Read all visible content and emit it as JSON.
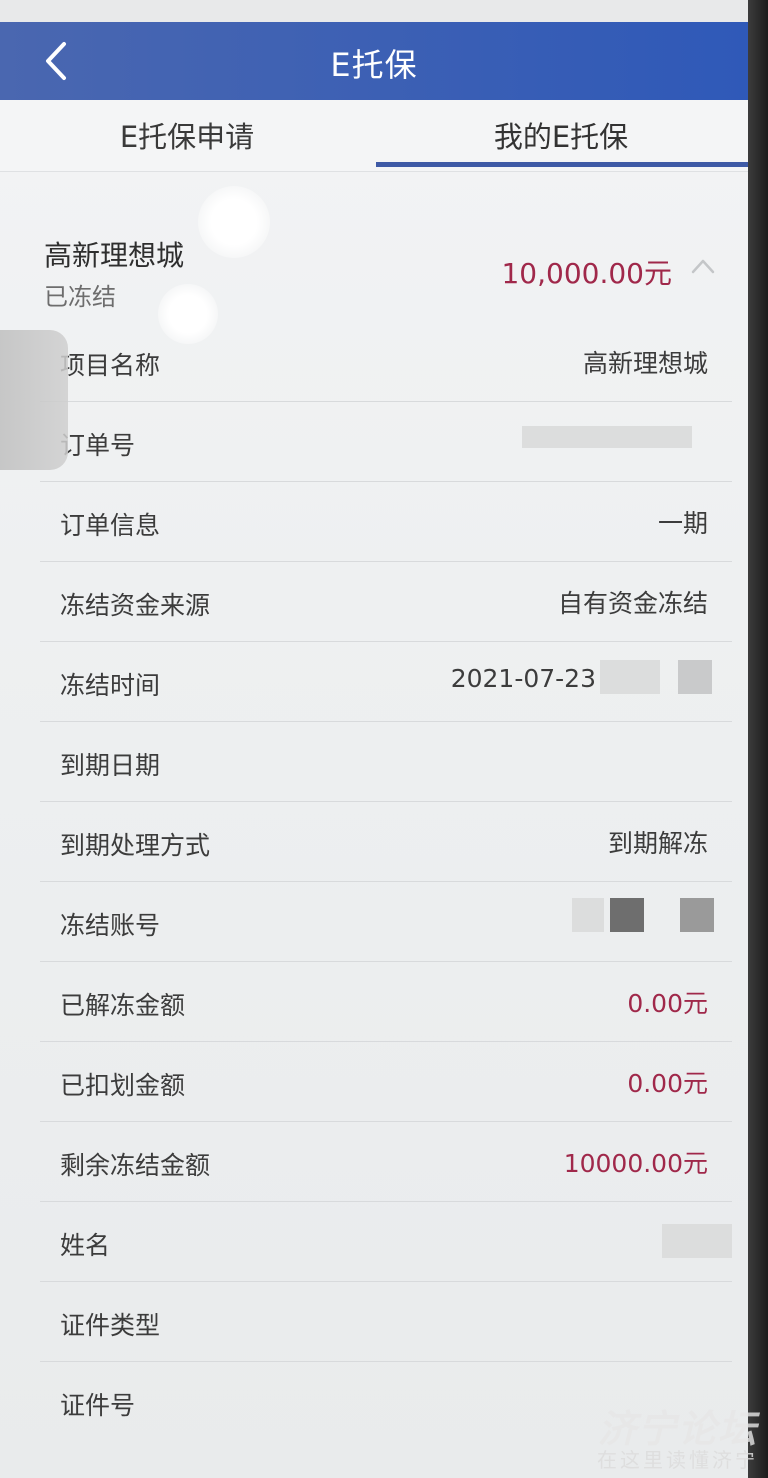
{
  "header": {
    "title": "E托保"
  },
  "tabs": [
    {
      "label": "E托保申请",
      "active": false
    },
    {
      "label": "我的E托保",
      "active": true
    }
  ],
  "summary": {
    "project_name": "高新理想城",
    "status": "已冻结",
    "amount": "10,000.00元"
  },
  "details": [
    {
      "label": "项目名称",
      "value": "高新理想城"
    },
    {
      "label": "订单号",
      "value": ""
    },
    {
      "label": "订单信息",
      "value": "一期"
    },
    {
      "label": "冻结资金来源",
      "value": "自有资金冻结"
    },
    {
      "label": "冻结时间",
      "value": "2021-07-23"
    },
    {
      "label": "到期日期",
      "value": ""
    },
    {
      "label": "到期处理方式",
      "value": "到期解冻"
    },
    {
      "label": "冻结账号",
      "value": ""
    },
    {
      "label": "已解冻金额",
      "value": "0.00元"
    },
    {
      "label": "已扣划金额",
      "value": "0.00元"
    },
    {
      "label": "剩余冻结金额",
      "value": "10000.00元"
    },
    {
      "label": "姓名",
      "value": ""
    },
    {
      "label": "证件类型",
      "value": ""
    },
    {
      "label": "证件号",
      "value": ""
    }
  ],
  "watermark": {
    "main": "济宁论坛",
    "sub": "在这里读懂济宁"
  },
  "colors": {
    "nav": "#2f59b8",
    "accent_red": "#a0284a",
    "tab_indicator": "#3e5aa6"
  }
}
